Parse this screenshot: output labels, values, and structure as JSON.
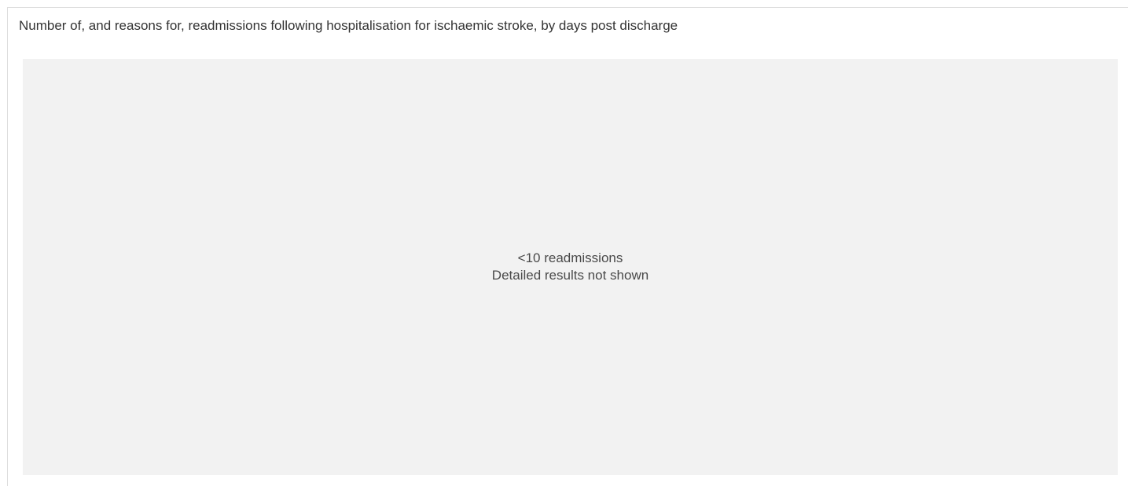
{
  "panel": {
    "title": "Number of, and reasons for, readmissions following hospitalisation for ischaemic stroke, by days post discharge"
  },
  "placeholder": {
    "line1": "<10 readmissions",
    "line2": "Detailed results not shown"
  },
  "colors": {
    "placeholder_background": "#f2f2f2",
    "border": "#dddddd",
    "text": "#333333"
  }
}
